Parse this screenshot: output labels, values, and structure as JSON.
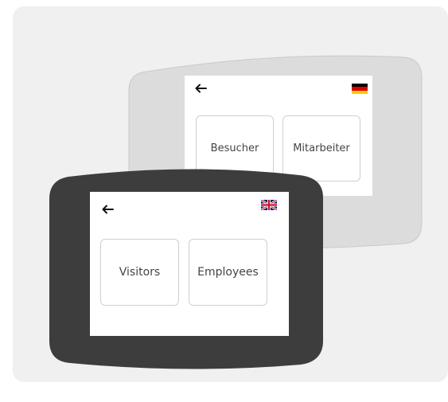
{
  "back_device": {
    "language_flag": "german-flag-icon",
    "back_icon": "arrow-left-icon",
    "buttons": [
      {
        "label": "Besucher"
      },
      {
        "label": "Mitarbeiter"
      }
    ],
    "bezel_color": "#dcdcdc"
  },
  "front_device": {
    "language_flag": "uk-flag-icon",
    "back_icon": "arrow-left-icon",
    "buttons": [
      {
        "label": "Visitors"
      },
      {
        "label": "Employees"
      }
    ],
    "bezel_color": "#3d3d3d"
  },
  "colors": {
    "card_background": "#f0f0f0",
    "screen_background": "#ffffff",
    "tile_border": "#cfcfcf"
  }
}
